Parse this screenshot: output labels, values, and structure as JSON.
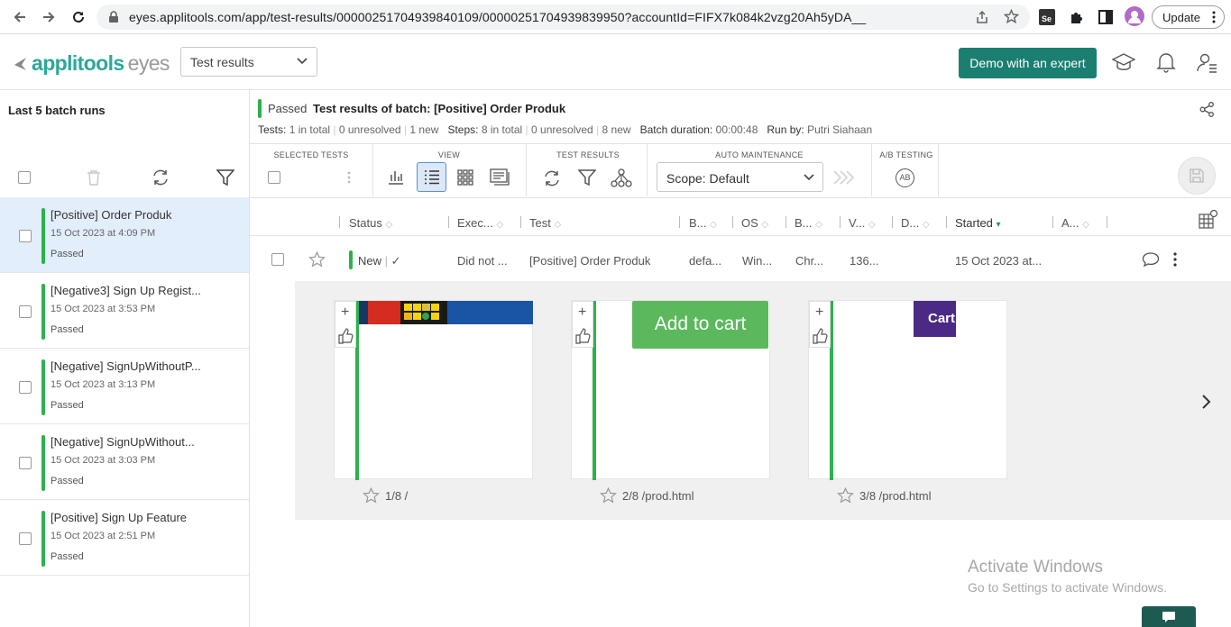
{
  "browser": {
    "url": "eyes.applitools.com/app/test-results/00000251704939840109/00000251704939839950?accountId=FIFX7k084k2vzg20Ah5yDA__",
    "update_label": "Update"
  },
  "header": {
    "logo_main": "applitools",
    "logo_sub": "eyes",
    "view_select": "Test results",
    "demo_button": "Demo with an expert"
  },
  "sidebar": {
    "title": "Last 5 batch runs",
    "items": [
      {
        "title": "[Positive] Order Produk",
        "date": "15 Oct 2023 at 4:09 PM",
        "status": "Passed"
      },
      {
        "title": "[Negative3] Sign Up Regist...",
        "date": "15 Oct 2023 at 3:53 PM",
        "status": "Passed"
      },
      {
        "title": "[Negative] SignUpWithoutP...",
        "date": "15 Oct 2023 at 3:13 PM",
        "status": "Passed"
      },
      {
        "title": "[Negative] SignUpWithout...",
        "date": "15 Oct 2023 at 3:03 PM",
        "status": "Passed"
      },
      {
        "title": "[Positive] Sign Up Feature",
        "date": "15 Oct 2023 at 2:51 PM",
        "status": "Passed"
      }
    ]
  },
  "batch": {
    "status": "Passed",
    "title_prefix": "Test results of batch:",
    "title": "[Positive] Order Produk",
    "tests_label": "Tests:",
    "tests_total": "1 in total",
    "tests_unresolved": "0 unresolved",
    "tests_new": "1 new",
    "steps_label": "Steps:",
    "steps_total": "8 in total",
    "steps_unresolved": "0 unresolved",
    "steps_new": "8 new",
    "duration_label": "Batch duration:",
    "duration": "00:00:48",
    "runby_label": "Run by:",
    "runby": "Putri Siahaan"
  },
  "toolbar": {
    "selected_tests": "SELECTED TESTS",
    "view": "VIEW",
    "test_results": "TEST RESULTS",
    "auto_maintenance": "AUTO MAINTENANCE",
    "scope": "Scope: Default",
    "ab_testing": "A/B TESTING",
    "ab_icon_text": "AB"
  },
  "columns": [
    "Status",
    "Exec...",
    "Test",
    "B...",
    "OS",
    "B...",
    "V...",
    "D...",
    "Started",
    "A..."
  ],
  "row": {
    "status": "New",
    "execution": "Did not ...",
    "test": "[Positive] Order Produk",
    "branch": "defa...",
    "os": "Win...",
    "browser": "Chr...",
    "viewport": "136...",
    "started": "15 Oct 2023 at..."
  },
  "steps": [
    {
      "label": "1/8 /"
    },
    {
      "label": "2/8 /prod.html",
      "thumb_text": "Add to cart"
    },
    {
      "label": "3/8 /prod.html",
      "thumb_text": "Cart"
    }
  ],
  "watermark": {
    "line1": "Activate Windows",
    "line2": "Go to Settings to activate Windows."
  },
  "colors": {
    "brand_teal": "#1a7f71",
    "passed_green": "#2db14e",
    "selected_row": "#e3eefc"
  }
}
